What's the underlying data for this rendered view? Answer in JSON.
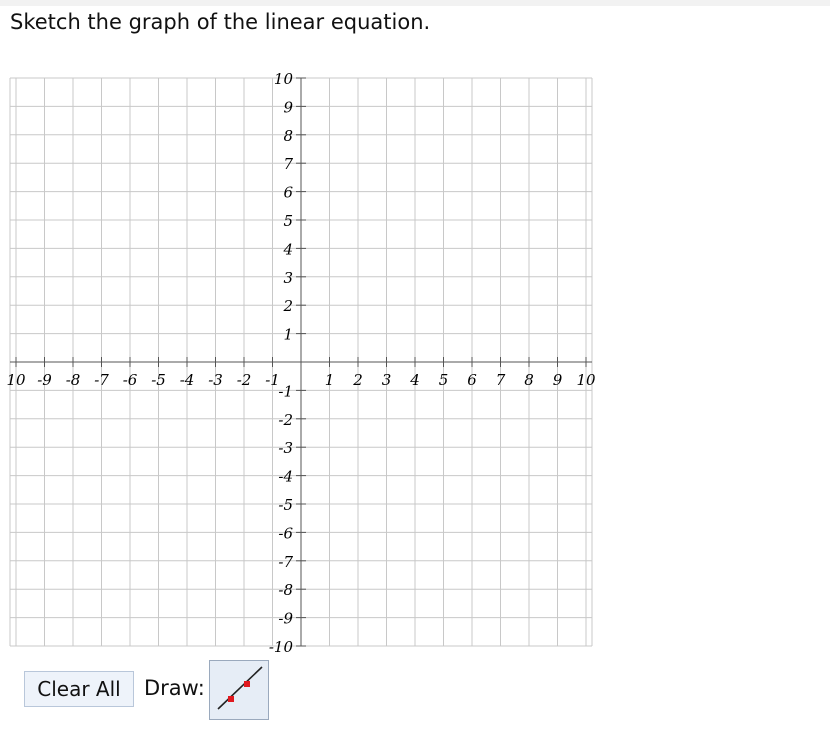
{
  "prompt": {
    "text": "Sketch the graph of the linear equation."
  },
  "graph": {
    "x_range": [
      -10,
      10
    ],
    "y_range": [
      -10,
      10
    ],
    "x_tick_labels": [
      "10",
      "-9",
      "-8",
      "-7",
      "-6",
      "-5",
      "-4",
      "-3",
      "-2",
      "-1",
      "1",
      "2",
      "3",
      "4",
      "5",
      "6",
      "7",
      "8",
      "9",
      "10"
    ],
    "y_tick_labels": [
      "10",
      "9",
      "8",
      "7",
      "6",
      "5",
      "4",
      "3",
      "2",
      "1",
      "-1",
      "-2",
      "-3",
      "-4",
      "-5",
      "-6",
      "-7",
      "-8",
      "-9",
      "-10"
    ],
    "grid": true,
    "colors": {
      "grid": "#c8c8c8",
      "axis": "#555555"
    }
  },
  "toolbar": {
    "clear_label": "Clear All",
    "draw_label": "Draw:",
    "draw_tool_icon": "line-segment-icon",
    "colors": {
      "endpoint": "#e0191f",
      "line": "#222222"
    }
  }
}
